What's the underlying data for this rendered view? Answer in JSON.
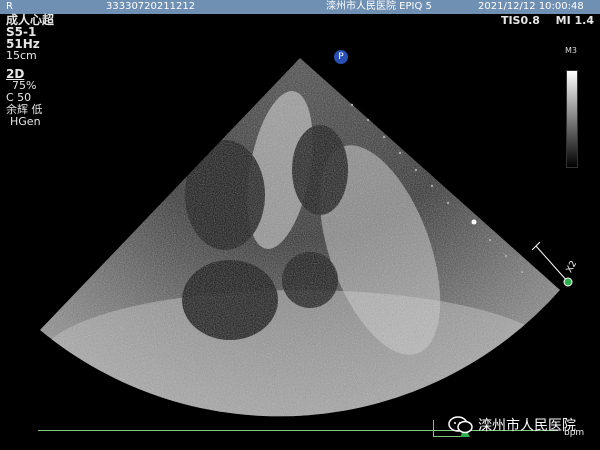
{
  "header": {
    "left": "R",
    "id": "33330720211212",
    "hospital_model": "滦州市人民医院 EPIQ 5",
    "datetime": "2021/12/12   10:00:48"
  },
  "left_panel": {
    "exam": "成人心超",
    "probe": "S5-1",
    "frame_rate": "51Hz",
    "depth": "15cm",
    "mode": "2D",
    "gain": "75%",
    "compression": "C 50",
    "persistence": "余辉 低",
    "harmonic": "HGen"
  },
  "right_metrics": {
    "tis": "TIS0.8",
    "mi": "MI 1.4"
  },
  "grayscale_label": "M3",
  "marker_p": "P",
  "axis_label": "X2",
  "watermark": {
    "text": "滦州市人民医院",
    "bpm": "bpm"
  }
}
